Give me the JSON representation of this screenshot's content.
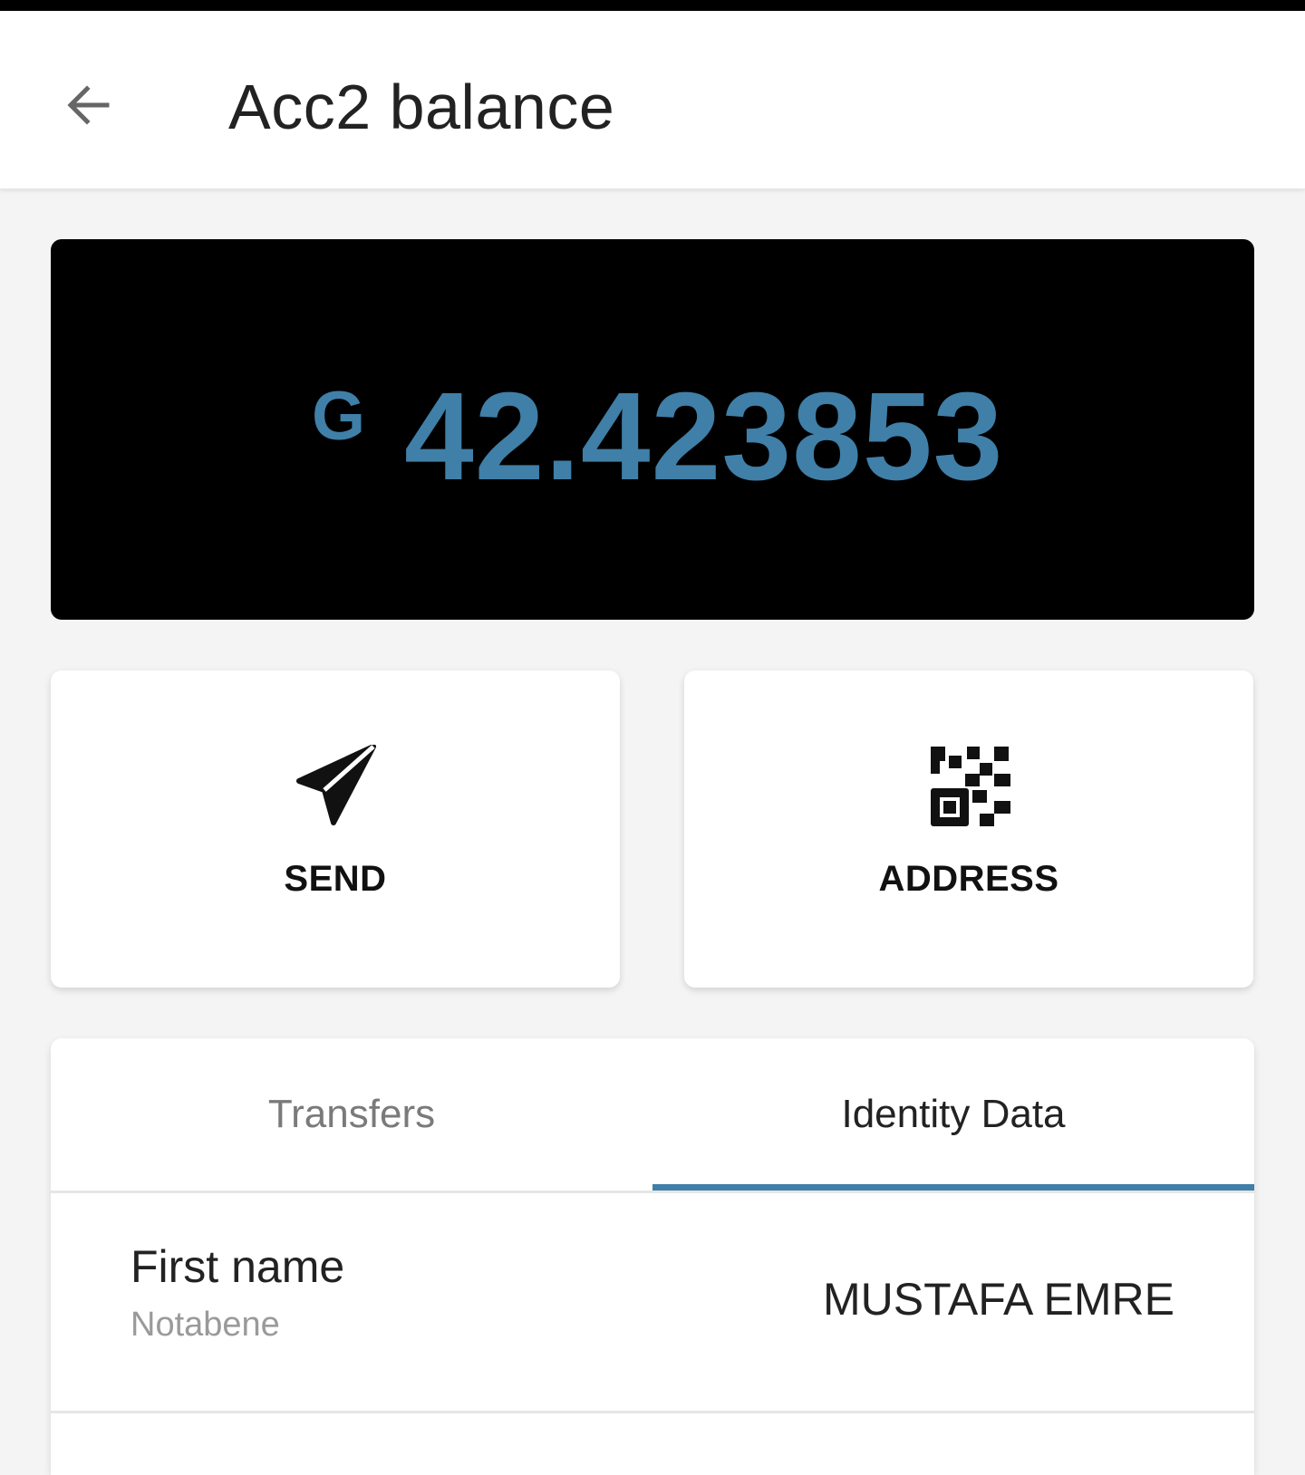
{
  "header": {
    "title": "Acc2 balance",
    "back_icon": "arrow-left-icon"
  },
  "balance": {
    "currency_symbol": "G",
    "amount": "42.423853",
    "amount_color": "#3f7fa8"
  },
  "actions": [
    {
      "label": "SEND",
      "icon": "send-icon"
    },
    {
      "label": "ADDRESS",
      "icon": "qr-code-icon"
    }
  ],
  "tabs": {
    "items": [
      {
        "label": "Transfers",
        "selected": false
      },
      {
        "label": "Identity Data",
        "selected": true
      }
    ],
    "indicator_color": "#3f7fa8"
  },
  "identity_data": {
    "rows": [
      {
        "label": "First name",
        "source": "Notabene",
        "value": "MUSTAFA EMRE"
      }
    ]
  }
}
